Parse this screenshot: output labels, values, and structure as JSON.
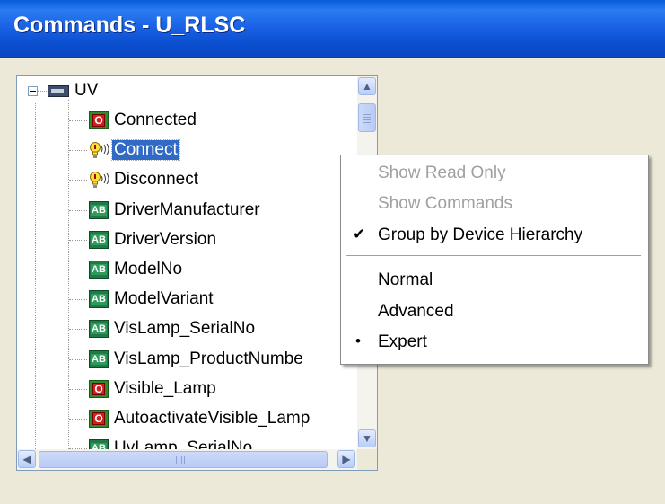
{
  "window": {
    "title": "Commands - U_RLSC"
  },
  "tree": {
    "root": {
      "label": "UV",
      "expander": "⊟"
    },
    "items": [
      {
        "label": "Connected",
        "icon": "io-icon"
      },
      {
        "label": "Connect",
        "icon": "command-bulb-icon",
        "selected": true
      },
      {
        "label": "Disconnect",
        "icon": "command-bulb-icon"
      },
      {
        "label": "DriverManufacturer",
        "icon": "ab-icon"
      },
      {
        "label": "DriverVersion",
        "icon": "ab-icon"
      },
      {
        "label": "ModelNo",
        "icon": "ab-icon"
      },
      {
        "label": "ModelVariant",
        "icon": "ab-icon"
      },
      {
        "label": "VisLamp_SerialNo",
        "icon": "ab-icon"
      },
      {
        "label": "VisLamp_ProductNumbe",
        "icon": "ab-icon"
      },
      {
        "label": "Visible_Lamp",
        "icon": "io-icon"
      },
      {
        "label": "AutoactivateVisible_Lamp",
        "icon": "io-icon"
      },
      {
        "label": "UvLamp_SerialNo",
        "icon": "ab-icon"
      }
    ],
    "icon_text": {
      "io": "O",
      "ab": "AB"
    }
  },
  "scrollbars": {
    "up": "▲",
    "down": "▼",
    "left": "◀",
    "right": "▶"
  },
  "context_menu": {
    "items": [
      {
        "label": "Show Read Only",
        "disabled": true,
        "mark": ""
      },
      {
        "label": "Show Commands",
        "disabled": true,
        "mark": ""
      },
      {
        "label": "Group by Device Hierarchy",
        "disabled": false,
        "mark": "✔"
      },
      {
        "label": "Normal",
        "disabled": false,
        "mark": ""
      },
      {
        "label": "Advanced",
        "disabled": false,
        "mark": ""
      },
      {
        "label": "Expert",
        "disabled": false,
        "mark": "•"
      }
    ]
  },
  "colors": {
    "titlebar": "#0a4fd0",
    "selection": "#316ac5",
    "window_bg": "#ece9d8"
  }
}
